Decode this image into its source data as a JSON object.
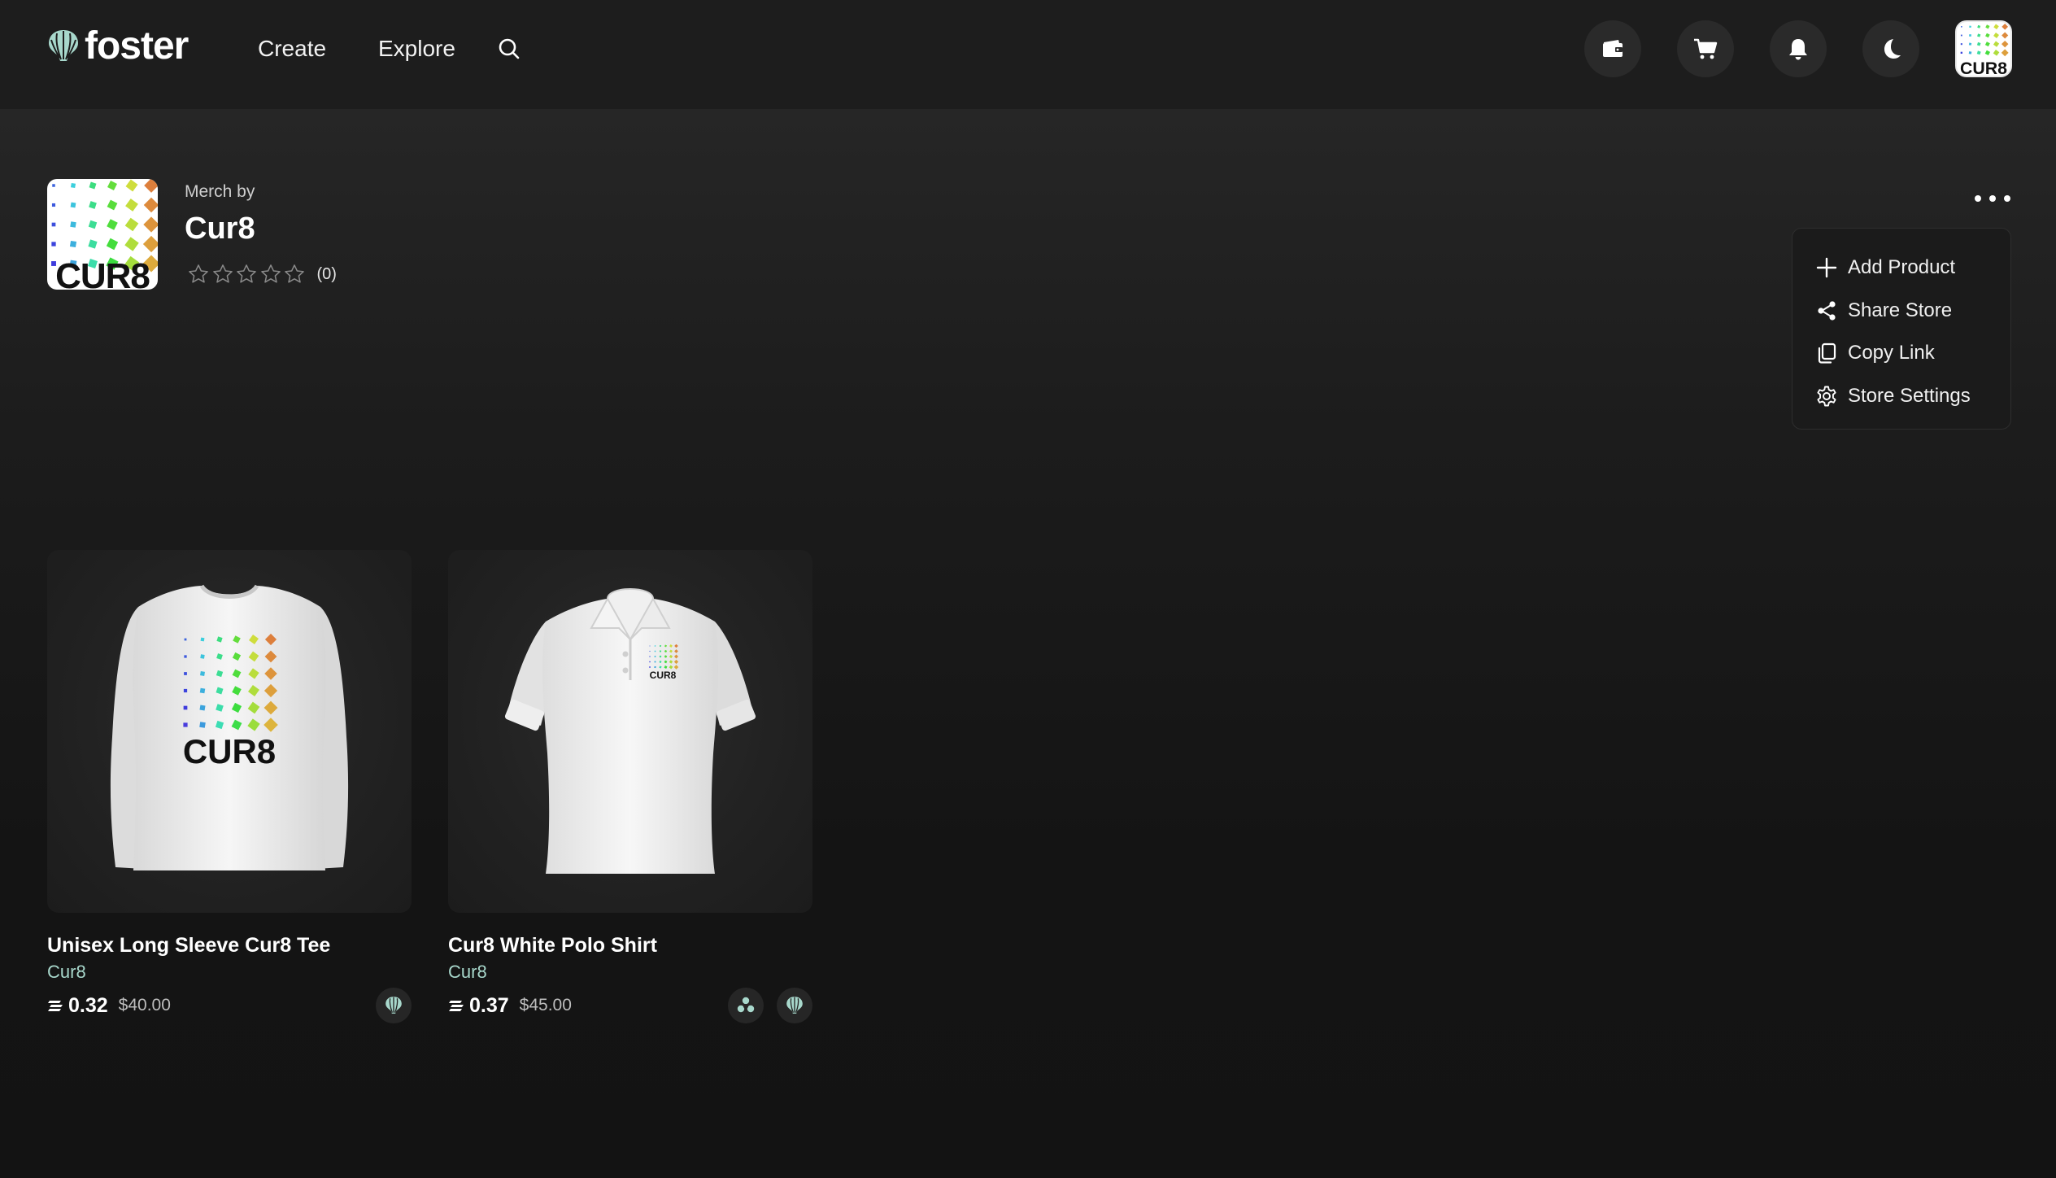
{
  "brand": {
    "name": "foster",
    "accent": "#a8d8cc"
  },
  "nav": {
    "create": "Create",
    "explore": "Explore"
  },
  "header_icons": [
    "wallet-icon",
    "cart-icon",
    "bell-icon",
    "moon-icon"
  ],
  "user_avatar_text": "CUR8",
  "store": {
    "merch_by": "Merch by",
    "name": "Cur8",
    "logo_text": "CUR8",
    "rating_stars": 0,
    "rating_max": 5,
    "rating_count": "(0)"
  },
  "menu": {
    "items": [
      {
        "label": "Add Product",
        "icon": "plus-icon"
      },
      {
        "label": "Share Store",
        "icon": "share-icon"
      },
      {
        "label": "Copy Link",
        "icon": "copy-icon"
      },
      {
        "label": "Store Settings",
        "icon": "gear-icon"
      }
    ]
  },
  "products": [
    {
      "title": "Unisex Long Sleeve Cur8 Tee",
      "seller": "Cur8",
      "price": "0.32",
      "price_usd": "$40.00",
      "print_text": "CUR8",
      "badges": [
        "foster-badge-icon"
      ]
    },
    {
      "title": "Cur8 White Polo Shirt",
      "seller": "Cur8",
      "price": "0.37",
      "price_usd": "$45.00",
      "print_text": "CUR8",
      "badges": [
        "cluster-badge-icon",
        "foster-badge-icon"
      ]
    }
  ]
}
